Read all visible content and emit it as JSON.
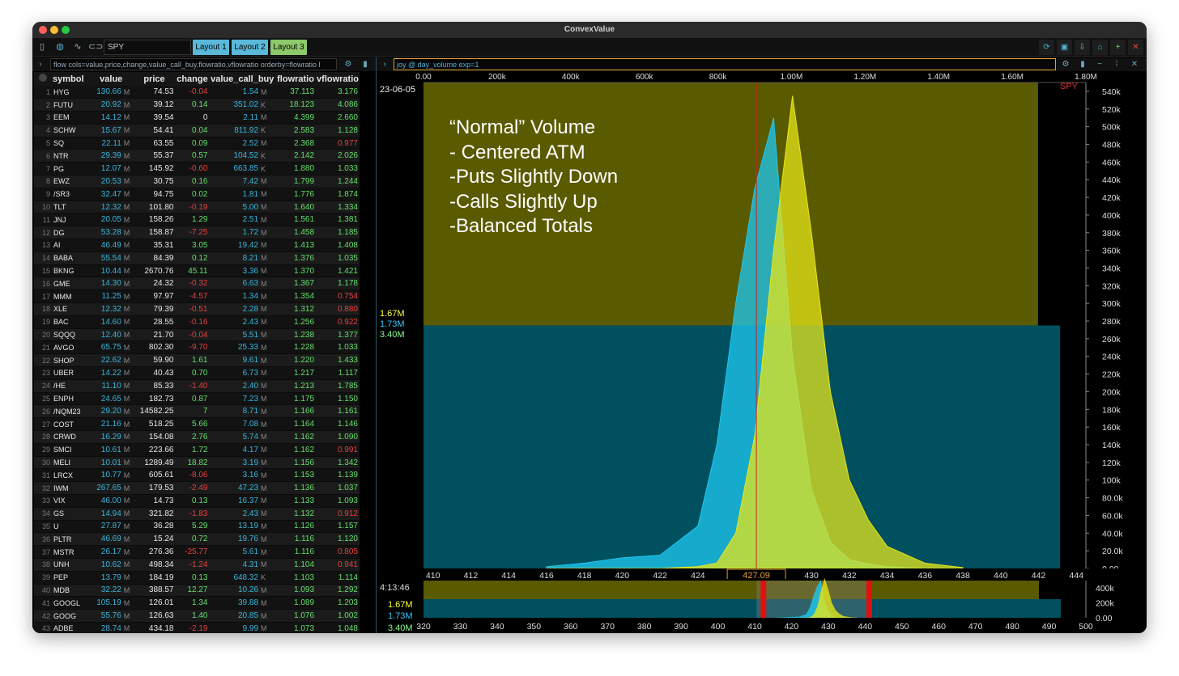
{
  "window": {
    "title": "ConvexValue"
  },
  "toolbar": {
    "symbol_value": "SPY",
    "layouts": [
      "Layout 1",
      "Layout 2",
      "Layout 3"
    ],
    "icons": [
      "sidebar-icon",
      "globe-icon",
      "pulse-icon",
      "link-icon"
    ],
    "right_icons": [
      "refresh-icon",
      "save-icon",
      "pin-icon",
      "home-icon",
      "add-icon",
      "close-icon"
    ]
  },
  "left_command": "flow cols=value,price,change,value_call_buy,flowratio,vflowratio orderby=flowratio l",
  "right_command": "joy @ day_volume exp=1",
  "table": {
    "columns": [
      "symbol",
      "value",
      "price",
      "change",
      "value_call_buy",
      "flowratio",
      "vflowratio"
    ],
    "rows": [
      [
        "1",
        "HYG",
        "130.66",
        "M",
        "74.53",
        "-0.04",
        "1.54",
        "M",
        "37.113",
        "3.176"
      ],
      [
        "2",
        "FUTU",
        "20.92",
        "M",
        "39.12",
        "0.14",
        "351.02",
        "K",
        "18.123",
        "4.086"
      ],
      [
        "3",
        "EEM",
        "14.12",
        "M",
        "39.54",
        "0",
        "2.11",
        "M",
        "4.399",
        "2.660"
      ],
      [
        "4",
        "SCHW",
        "15.67",
        "M",
        "54.41",
        "0.04",
        "811.92",
        "K",
        "2.583",
        "1.128"
      ],
      [
        "5",
        "SQ",
        "22.11",
        "M",
        "63.55",
        "0.09",
        "2.52",
        "M",
        "2.368",
        "0.977"
      ],
      [
        "6",
        "NTR",
        "29.39",
        "M",
        "55.37",
        "0.57",
        "104.52",
        "K",
        "2.142",
        "2.026"
      ],
      [
        "7",
        "PG",
        "12.07",
        "M",
        "145.92",
        "-0.60",
        "663.85",
        "K",
        "1.880",
        "1.033"
      ],
      [
        "8",
        "EWZ",
        "20.53",
        "M",
        "30.75",
        "0.16",
        "7.42",
        "M",
        "1.799",
        "1.244"
      ],
      [
        "9",
        "/SR3",
        "32.47",
        "M",
        "94.75",
        "0.02",
        "1.81",
        "M",
        "1.776",
        "1.874"
      ],
      [
        "10",
        "TLT",
        "12.32",
        "M",
        "101.80",
        "-0.19",
        "5.00",
        "M",
        "1.640",
        "1.334"
      ],
      [
        "11",
        "JNJ",
        "20.05",
        "M",
        "158.26",
        "1.29",
        "2.51",
        "M",
        "1.561",
        "1.381"
      ],
      [
        "12",
        "DG",
        "53.28",
        "M",
        "158.87",
        "-7.25",
        "1.72",
        "M",
        "1.458",
        "1.185"
      ],
      [
        "13",
        "AI",
        "46.49",
        "M",
        "35.31",
        "3.05",
        "19.42",
        "M",
        "1.413",
        "1.408"
      ],
      [
        "14",
        "BABA",
        "55.54",
        "M",
        "84.39",
        "0.12",
        "8.21",
        "M",
        "1.376",
        "1.035"
      ],
      [
        "15",
        "BKNG",
        "10.44",
        "M",
        "2670.76",
        "45.11",
        "3.36",
        "M",
        "1.370",
        "1.421"
      ],
      [
        "16",
        "GME",
        "14.30",
        "M",
        "24.32",
        "-0.32",
        "6.63",
        "M",
        "1.367",
        "1.178"
      ],
      [
        "17",
        "MMM",
        "11.25",
        "M",
        "97.97",
        "-4.57",
        "1.34",
        "M",
        "1.354",
        "0.754"
      ],
      [
        "18",
        "XLE",
        "12.32",
        "M",
        "79.39",
        "-0.51",
        "2.28",
        "M",
        "1.312",
        "0.880"
      ],
      [
        "19",
        "BAC",
        "14.60",
        "M",
        "28.55",
        "-0.16",
        "2.43",
        "M",
        "1.256",
        "0.922"
      ],
      [
        "20",
        "SQQQ",
        "12.40",
        "M",
        "21.70",
        "-0.04",
        "5.51",
        "M",
        "1.238",
        "1.377"
      ],
      [
        "21",
        "AVGO",
        "65.75",
        "M",
        "802.30",
        "-9.70",
        "25.33",
        "M",
        "1.228",
        "1.033"
      ],
      [
        "22",
        "SHOP",
        "22.62",
        "M",
        "59.90",
        "1.61",
        "9.61",
        "M",
        "1.220",
        "1.433"
      ],
      [
        "23",
        "UBER",
        "14.22",
        "M",
        "40.43",
        "0.70",
        "6.73",
        "M",
        "1.217",
        "1.117"
      ],
      [
        "24",
        "/HE",
        "11.10",
        "M",
        "85.33",
        "-1.40",
        "2.40",
        "M",
        "1.213",
        "1.785"
      ],
      [
        "25",
        "ENPH",
        "24.65",
        "M",
        "182.73",
        "0.87",
        "7.23",
        "M",
        "1.175",
        "1.150"
      ],
      [
        "26",
        "/NQM23",
        "29.20",
        "M",
        "14582.25",
        "7",
        "8.71",
        "M",
        "1.166",
        "1.161"
      ],
      [
        "27",
        "COST",
        "21.16",
        "M",
        "518.25",
        "5.66",
        "7.08",
        "M",
        "1.164",
        "1.146"
      ],
      [
        "28",
        "CRWD",
        "16.29",
        "M",
        "154.08",
        "2.76",
        "5.74",
        "M",
        "1.162",
        "1.090"
      ],
      [
        "29",
        "SMCI",
        "10.61",
        "M",
        "223.66",
        "1.72",
        "4.17",
        "M",
        "1.162",
        "0.991"
      ],
      [
        "30",
        "MELI",
        "10.01",
        "M",
        "1289.49",
        "18.82",
        "3.19",
        "M",
        "1.156",
        "1.342"
      ],
      [
        "31",
        "LRCX",
        "10.77",
        "M",
        "605.61",
        "-8.06",
        "3.16",
        "M",
        "1.153",
        "1.139"
      ],
      [
        "32",
        "IWM",
        "267.65",
        "M",
        "179.53",
        "-2.49",
        "47.23",
        "M",
        "1.136",
        "1.037"
      ],
      [
        "33",
        "VIX",
        "46.00",
        "M",
        "14.73",
        "0.13",
        "16.37",
        "M",
        "1.133",
        "1.093"
      ],
      [
        "34",
        "GS",
        "14.94",
        "M",
        "321.82",
        "-1.83",
        "2.43",
        "M",
        "1.132",
        "0.912"
      ],
      [
        "35",
        "U",
        "27.87",
        "M",
        "36.28",
        "5.29",
        "13.19",
        "M",
        "1.126",
        "1.157"
      ],
      [
        "36",
        "PLTR",
        "46.69",
        "M",
        "15.24",
        "0.72",
        "19.76",
        "M",
        "1.116",
        "1.120"
      ],
      [
        "37",
        "MSTR",
        "26.17",
        "M",
        "276.36",
        "-25.77",
        "5.61",
        "M",
        "1.116",
        "0.805"
      ],
      [
        "38",
        "UNH",
        "10.62",
        "M",
        "498.34",
        "-1.24",
        "4.31",
        "M",
        "1.104",
        "0.941"
      ],
      [
        "39",
        "PEP",
        "13.79",
        "M",
        "184.19",
        "0.13",
        "648.32",
        "K",
        "1.103",
        "1.114"
      ],
      [
        "40",
        "MDB",
        "32.22",
        "M",
        "388.57",
        "12.27",
        "10.26",
        "M",
        "1.093",
        "1.292"
      ],
      [
        "41",
        "GOOGL",
        "105.19",
        "M",
        "126.01",
        "1.34",
        "39.88",
        "M",
        "1.089",
        "1.203"
      ],
      [
        "42",
        "GOOG",
        "55.76",
        "M",
        "126.63",
        "1.40",
        "20.85",
        "M",
        "1.076",
        "1.002"
      ],
      [
        "43",
        "ADBE",
        "28.74",
        "M",
        "434.18",
        "-2.19",
        "9.99",
        "M",
        "1.073",
        "1.048"
      ]
    ]
  },
  "chart": {
    "date": "23-06-05",
    "symbol": "SPY",
    "current_price": "427.09",
    "time": "4:13:46",
    "totals": {
      "calls": "1.67M",
      "puts": "1.73M",
      "sum": "3.40M"
    },
    "top_axis_ticks": [
      "0.00",
      "200k",
      "400k",
      "600k",
      "800k",
      "1.00M",
      "1.20M",
      "1.40M",
      "1.60M",
      "1.80M"
    ],
    "y_axis_ticks": [
      "0.00",
      "20.0k",
      "40.0k",
      "60.0k",
      "80.0k",
      "100k",
      "120k",
      "140k",
      "160k",
      "180k",
      "200k",
      "220k",
      "240k",
      "260k",
      "280k",
      "300k",
      "320k",
      "340k",
      "360k",
      "380k",
      "400k",
      "420k",
      "440k",
      "460k",
      "480k",
      "500k",
      "520k",
      "540k"
    ],
    "x_axis_ticks": [
      "410",
      "412",
      "414",
      "416",
      "418",
      "420",
      "422",
      "424",
      "426",
      "428",
      "430",
      "432",
      "434",
      "436",
      "438",
      "440",
      "442",
      "444"
    ],
    "mini_x_ticks": [
      "320",
      "330",
      "340",
      "350",
      "360",
      "370",
      "380",
      "390",
      "400",
      "410",
      "420",
      "430",
      "440",
      "450",
      "460",
      "470",
      "480",
      "490",
      "500"
    ],
    "mini_y_ticks": [
      "0.00",
      "200k",
      "400k"
    ],
    "annotation": [
      "“Normal” Volume",
      "- Centered ATM",
      "-Puts Slightly Down",
      "-Calls Slightly Up",
      "-Balanced Totals"
    ],
    "colors": {
      "calls": "#e6e619",
      "puts": "#1ec8f0",
      "calls_total_bg": "#5a5a00",
      "puts_total_bg": "#00505f",
      "price_line": "#cc2222"
    }
  },
  "chart_data": {
    "type": "area",
    "title": "",
    "xlabel": "",
    "ylabel": "",
    "xlim": [
      409.5,
      444.5
    ],
    "ylim": [
      0,
      550000
    ],
    "top_axis_range": [
      0,
      1800000
    ],
    "grid": false,
    "legend": "none",
    "x": [
      416,
      418,
      420,
      422,
      424,
      425,
      426,
      427,
      428,
      429,
      430,
      431,
      432,
      433,
      434,
      436,
      438
    ],
    "series": [
      {
        "name": "puts",
        "values": [
          2000,
          6000,
          12000,
          15000,
          48000,
          140000,
          300000,
          430000,
          510000,
          240000,
          90000,
          30000,
          10000,
          5000,
          2000,
          0,
          0
        ]
      },
      {
        "name": "calls",
        "values": [
          0,
          0,
          0,
          0,
          2000,
          6000,
          40000,
          150000,
          360000,
          535000,
          380000,
          200000,
          100000,
          55000,
          25000,
          6000,
          1000
        ]
      }
    ],
    "totals": {
      "calls": 1670000,
      "puts": 1730000,
      "sum": 3400000
    },
    "current_price": 427.09
  }
}
